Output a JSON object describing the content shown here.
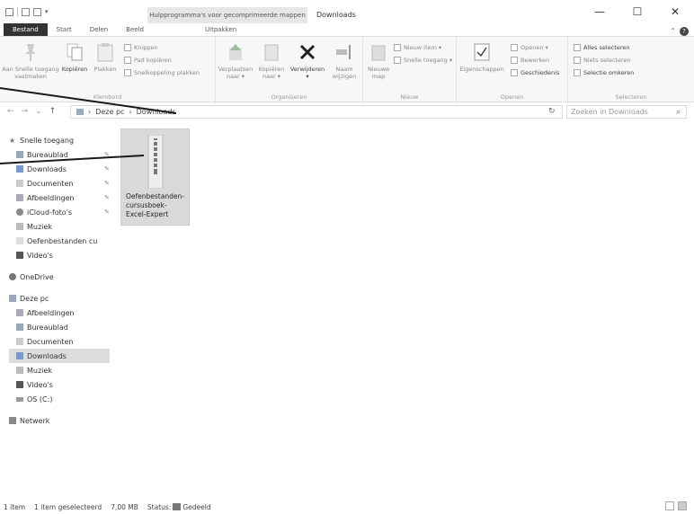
{
  "window": {
    "title": "Downloads",
    "context_tab_header": "Hulpprogramma's voor gecomprimeerde mappen",
    "minimize": "—",
    "maximize": "☐",
    "close": "✕"
  },
  "tabs": {
    "file": "Bestand",
    "start": "Start",
    "share": "Delen",
    "view": "Beeld",
    "extract": "Uitpakken"
  },
  "ribbon": {
    "clipboard": {
      "label": "Klembord",
      "pin": "Aan Snelle toegang vastmaken",
      "copy": "Kopiëren",
      "paste": "Plakken",
      "cut": "Knippen",
      "copy_path": "Pad kopiëren",
      "paste_shortcut": "Snelkoppeling plakken"
    },
    "organize": {
      "label": "Organiseren",
      "move_to": "Verplaatsen naar ▾",
      "copy_to": "Kopiëren naar ▾",
      "delete": "Verwijderen ▾",
      "rename": "Naam wijzigen"
    },
    "new": {
      "label": "Nieuw",
      "new_folder": "Nieuwe map",
      "new_item": "Nieuw item ▾",
      "easy_access": "Snelle toegang ▾"
    },
    "open": {
      "label": "Openen",
      "properties": "Eigenschappen",
      "open": "Openen ▾",
      "edit": "Bewerken",
      "history": "Geschiedenis"
    },
    "select": {
      "label": "Selecteren",
      "select_all": "Alles selecteren",
      "select_none": "Niets selecteren",
      "invert": "Selectie omkeren"
    }
  },
  "address": {
    "back": "←",
    "forward": "→",
    "recent": "⌄",
    "up": "↑",
    "crumbs": [
      "Deze pc",
      "Downloads"
    ],
    "separator": "›",
    "refresh": "↻",
    "search_placeholder": "Zoeken in Downloads"
  },
  "sidebar": {
    "quick_access": "Snelle toegang",
    "quick_items": [
      "Bureaublad",
      "Downloads",
      "Documenten",
      "Afbeeldingen",
      "iCloud-foto's",
      "Muziek",
      "Oefenbestanden cu",
      "Video's"
    ],
    "onedrive": "OneDrive",
    "this_pc": "Deze pc",
    "pc_items": [
      "Afbeeldingen",
      "Bureaublad",
      "Documenten",
      "Downloads",
      "Muziek",
      "Video's",
      "OS (C:)"
    ],
    "network": "Netwerk"
  },
  "content": {
    "file_name": "Oefenbestanden-cursusboek-Excel-Expert"
  },
  "status": {
    "count": "1 item",
    "selected": "1 item geselecteerd",
    "size": "7,00 MB",
    "state_label": "Status:",
    "state_value": "Gedeeld"
  },
  "colors": {
    "file_tab": "#333333",
    "selection": "#d9d9d9",
    "callout_line": "#1a1a1a"
  }
}
